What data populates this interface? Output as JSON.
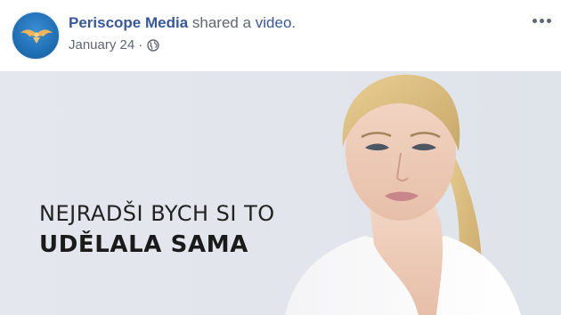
{
  "post": {
    "page_name": "Periscope Media",
    "action_text": " shared a ",
    "object_text": "video",
    "object_suffix": ".",
    "date": "January 24",
    "separator": "·",
    "privacy_icon": "globe-icon",
    "more_icon": "more-horizontal-icon"
  },
  "video": {
    "caption_line1": "NEJRADŠI BYCH SI TO",
    "caption_line2": "UDĚLALA SAMA",
    "subject": "woman-portrait"
  },
  "colors": {
    "link": "#385898",
    "meta": "#606770",
    "avatar": "#1f6fb5",
    "video_bg": "#e2e5ec"
  }
}
